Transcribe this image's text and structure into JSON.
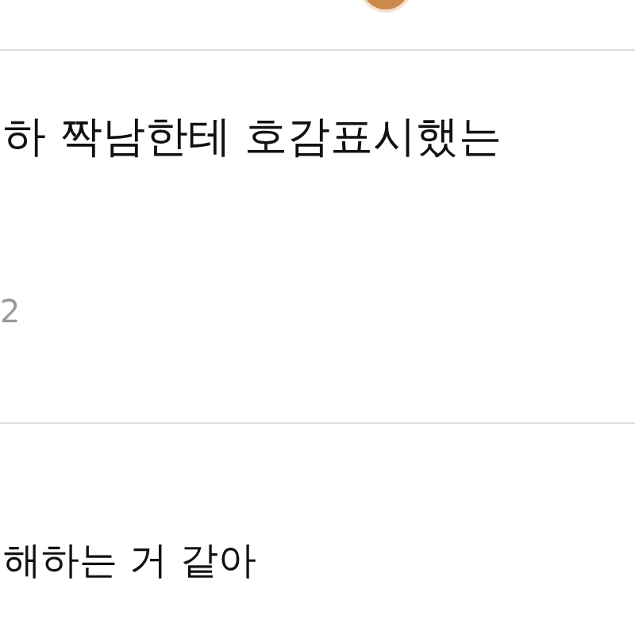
{
  "post": {
    "title": "하 짝남한테 호감표시했는",
    "count": "2"
  },
  "comment": {
    "text": "해하는 거 같아"
  }
}
